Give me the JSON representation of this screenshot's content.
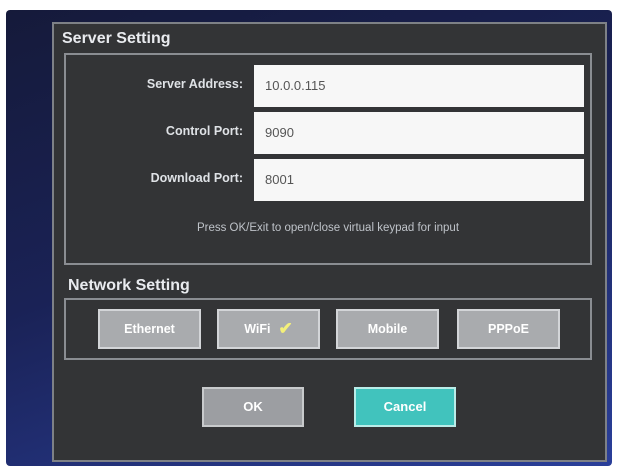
{
  "server_setting": {
    "title": "Server Setting",
    "fields": [
      {
        "label": "Server Address:",
        "value": "10.0.0.115"
      },
      {
        "label": "Control Port:",
        "value": "9090"
      },
      {
        "label": "Download Port:",
        "value": "8001"
      }
    ],
    "hint": "Press OK/Exit to open/close virtual keypad for input"
  },
  "network_setting": {
    "title": "Network Setting",
    "options": [
      {
        "label": "Ethernet",
        "selected": false
      },
      {
        "label": "WiFi",
        "selected": true
      },
      {
        "label": "Mobile",
        "selected": false
      },
      {
        "label": "PPPoE",
        "selected": false
      }
    ],
    "check_icon": "checkmark-icon",
    "check_color": "#f4f07a"
  },
  "actions": {
    "ok_label": "OK",
    "cancel_label": "Cancel",
    "cancel_color": "#41c3bd"
  }
}
